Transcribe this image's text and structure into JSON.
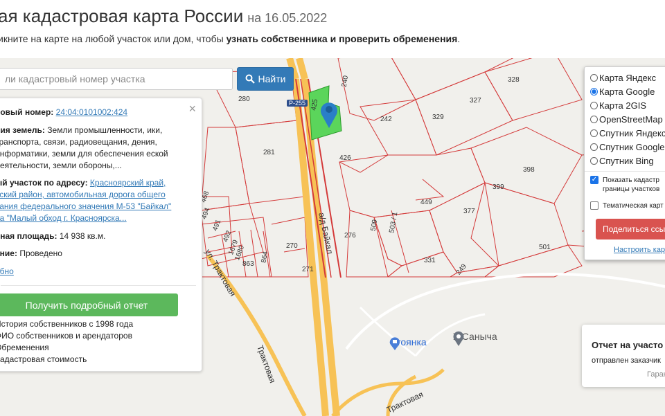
{
  "header": {
    "title": "ая кадастровая карта России",
    "date": "на 16.05.2022",
    "subtitle_prefix": "икните на карте на любой участок или дом, чтобы ",
    "subtitle_bold": "узнать собственника и проверить обременения",
    "subtitle_suffix": "."
  },
  "search": {
    "placeholder": "ли кадастровый номер участка",
    "button_label": "Найти"
  },
  "info_panel": {
    "close": "×",
    "cadastral_label": "ровый номер:",
    "cadastral_value": "24:04:0101002:424",
    "category_label": "рия земель:",
    "category_value": "Земли промышленности, ики, транспорта, связи, радиовещания, дения, информатики, земли для обеспечения еской деятельности, земли обороны,...",
    "address_label": "ый участок по адресу:",
    "address_value": "Красноярский край, вский район, автомобильная дорога общего вания федерального значения М-53 \"Байкал\" на \"Малый обход г. Красноярска...",
    "area_label": "нная площадь:",
    "area_value": "14 938 кв.м.",
    "status_label": "ание:",
    "status_value": "Проведено",
    "more_link": "обно",
    "report_button": "Получить подробный отчет",
    "features": [
      "История собственников с 1998 года",
      "ФИО собственников и арендаторов",
      "Обременения",
      "Кадастровая стоимость"
    ]
  },
  "layers": {
    "options": [
      {
        "label": "Карта Яндекс",
        "checked": false
      },
      {
        "label": "Карта Google",
        "checked": true
      },
      {
        "label": "Карта 2GIS",
        "checked": false
      },
      {
        "label": "OpenStreetMap",
        "checked": false
      },
      {
        "label": "Спутник Яндекс",
        "checked": false
      },
      {
        "label": "Спутник Google",
        "checked": false
      },
      {
        "label": "Спутник Bing",
        "checked": false
      }
    ],
    "show_cadastral_line1": "Показать кадастр",
    "show_cadastral_line2": "границы участков",
    "thematic": "Тематическая карт",
    "share_button": "Поделиться ссыл",
    "setup_link": "Настроить карт"
  },
  "toast": {
    "title": "Отчет на участо",
    "body": "отправлен заказчик",
    "signature": "Гаран"
  },
  "map": {
    "parcel_labels": [
      "280",
      "240",
      "328",
      "425",
      "327",
      "242",
      "329",
      "281",
      "426",
      "398",
      "399",
      "449",
      "377",
      "509",
      "503 / 1",
      "276",
      "468",
      "494",
      "491",
      "492",
      "1679",
      "1680",
      "270",
      "864",
      "863",
      "271",
      "331",
      "249",
      "501"
    ],
    "road_p255": "Р-255",
    "road_baikal": "а/д Байкал",
    "street_1": "ул. Трактовая",
    "street_2": "Трактовая",
    "street_3": "Трактовая",
    "poi_parking": "Стоянка",
    "poi_shop": "У Саныча"
  }
}
